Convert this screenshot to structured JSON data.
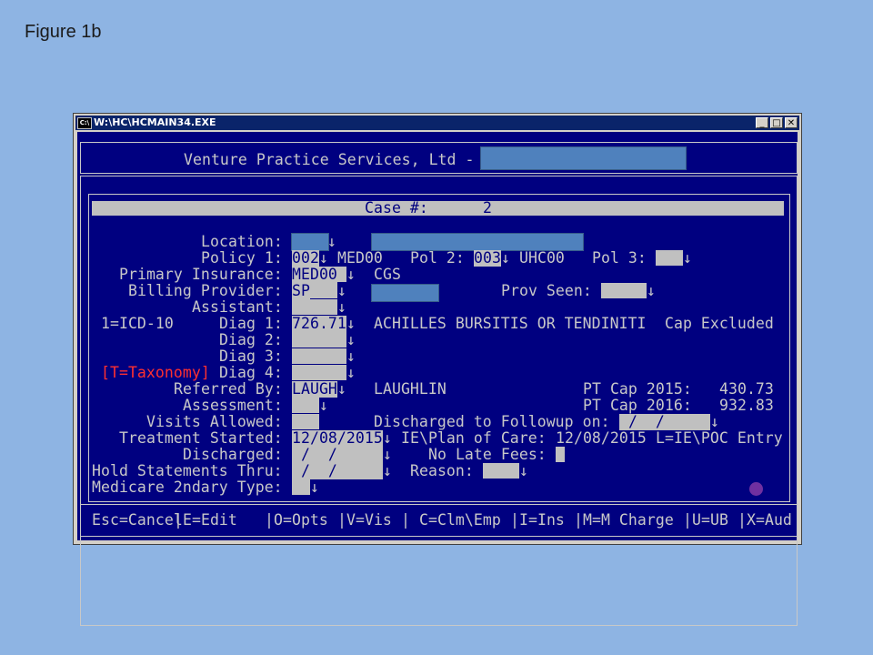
{
  "figure_label": "Figure 1b",
  "window": {
    "title": "W:\\HC\\HCMAIN34.EXE",
    "icon": "C:\\",
    "minimize": "_",
    "maximize": "□",
    "close": "✕"
  },
  "header": {
    "company": "Venture Practice Services, Ltd -"
  },
  "case": {
    "label": "Case #:",
    "number": "2"
  },
  "labels": {
    "location": "Location:",
    "policy1": "Policy 1:",
    "pol2": "Pol 2:",
    "pol3": "Pol 3:",
    "primary_insurance": "Primary Insurance:",
    "billing_provider": "Billing Provider:",
    "prov_seen": "Prov Seen:",
    "assistant": "Assistant:",
    "icd_mode": "1=ICD-10",
    "diag1": "Diag 1:",
    "diag2": "Diag 2:",
    "diag3": "Diag 3:",
    "taxonomy_hint": "[T=Taxonomy]",
    "diag4": "Diag 4:",
    "referred_by": "Referred By:",
    "assessment": "Assessment:",
    "visits_allowed": "Visits Allowed:",
    "treatment_started": "Treatment Started:",
    "discharged": "Discharged:",
    "hold_statements": "Hold Statements Thru:",
    "medicare_2ndary": "Medicare 2ndary Type:",
    "pt_cap_2015": "PT Cap 2015:",
    "pt_cap_2016": "PT Cap 2016:",
    "discharged_followup": "Discharged to Followup on:",
    "plan_of_care": "IE\\Plan of Care:",
    "poc_hint": "L=IE\\POC Entry",
    "no_late_fees": "No Late Fees:",
    "reason": "Reason:"
  },
  "values": {
    "policy1_code": "002",
    "policy1_name": "MED00",
    "pol2_code": "003",
    "pol2_name": "UHC00",
    "primary_insurance_code": "MED00",
    "primary_insurance_name": "CGS",
    "billing_provider": "SP",
    "diag1_code": "726.71",
    "diag1_desc": "ACHILLES BURSITIS OR TENDINITI",
    "cap_status": "Cap Excluded",
    "referred_code": "LAUGH",
    "referred_name": "LAUGHLIN",
    "pt_cap_2015": "430.73",
    "pt_cap_2016": "932.83",
    "followup_date": " /  / ",
    "treatment_started": "12/08/2015",
    "plan_of_care_date": "12/08/2015",
    "discharged_date": " /  / ",
    "hold_date": " /  / "
  },
  "arrow": "↓",
  "footer": [
    "Esc=Cancel",
    "E=Edit",
    "O=Opts",
    "V=Vis",
    "C=Clm\\Emp",
    "I=Ins",
    "M=M Charge",
    "U=UB",
    "X=Aud"
  ],
  "footer_sep": "|",
  "colors": {
    "console_bg": "#000080",
    "text": "#c8c8c8",
    "field_bg": "#c0c0c0",
    "redaction": "#4f81bd",
    "page_bg": "#8eb4e3",
    "taxonomy_red": "#ff3030",
    "marker": "#7030a0"
  }
}
